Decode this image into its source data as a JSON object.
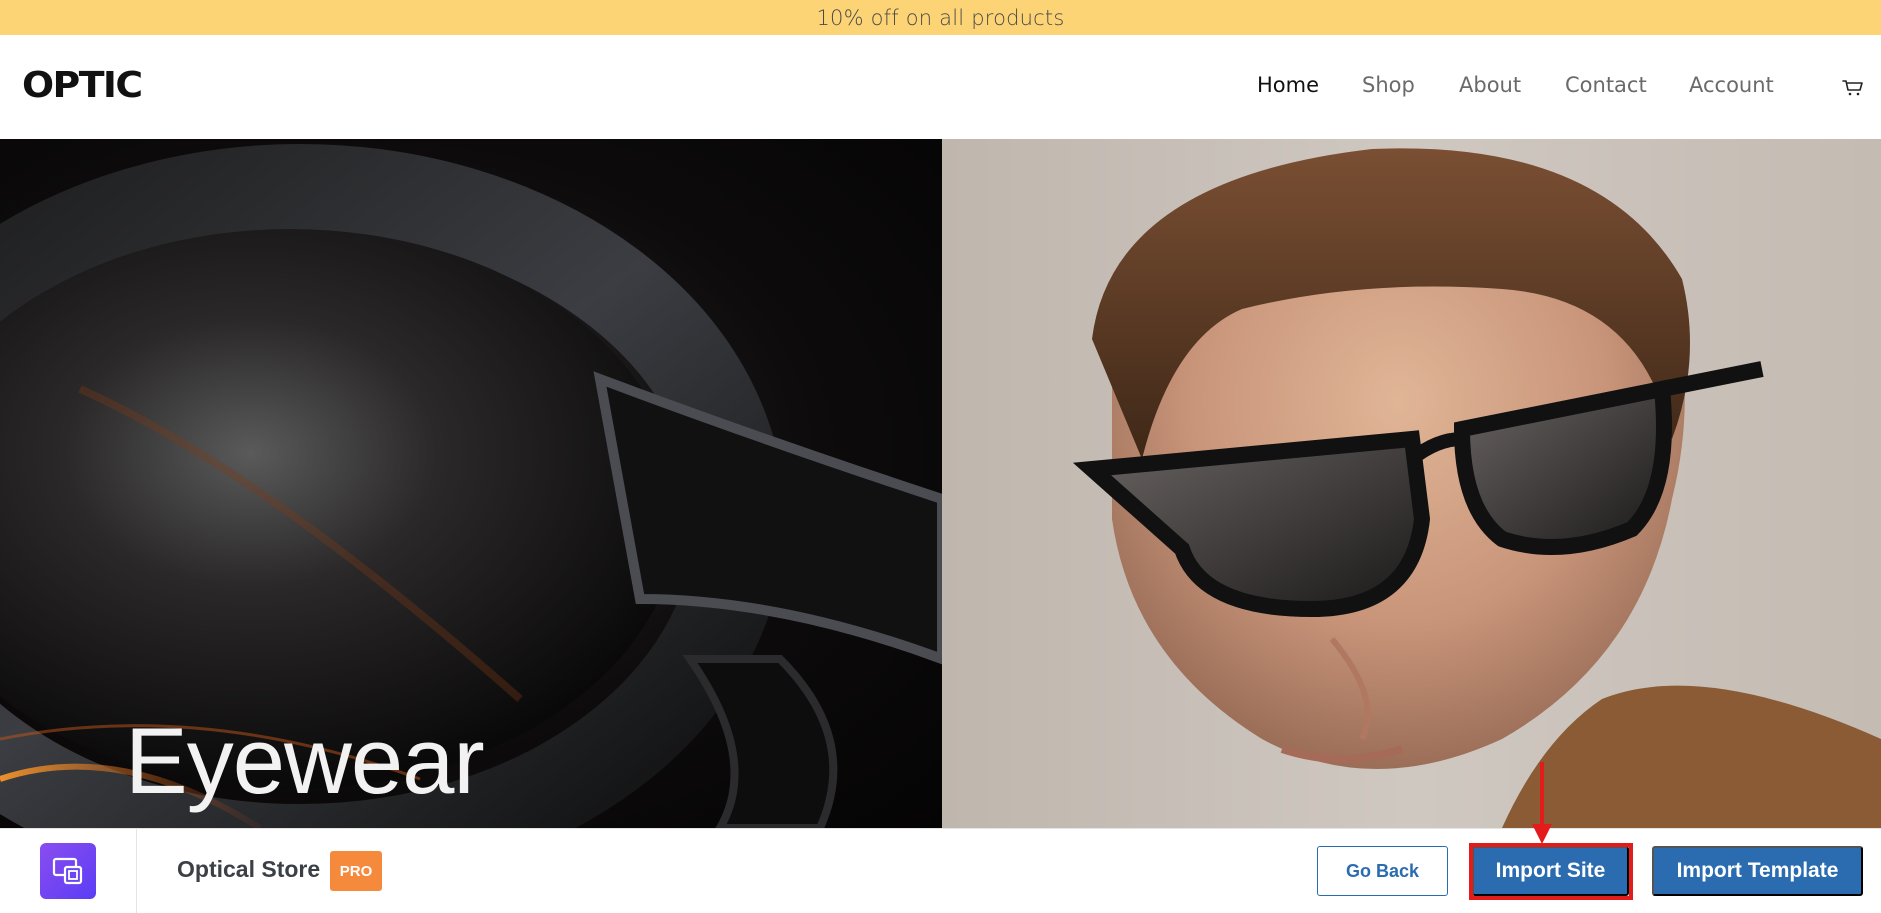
{
  "promo": {
    "text": "10% off on all products"
  },
  "header": {
    "logo": "OPTIC",
    "nav": [
      {
        "label": "Home",
        "active": true
      },
      {
        "label": "Shop",
        "active": false
      },
      {
        "label": "About",
        "active": false
      },
      {
        "label": "Contact",
        "active": false
      },
      {
        "label": "Account",
        "active": false
      }
    ],
    "cart_icon": "cart-icon"
  },
  "hero": {
    "title": "Eyewear",
    "left_image": "sunglasses-closeup",
    "right_image": "man-wearing-sunglasses"
  },
  "import_bar": {
    "site_name": "Optical Store",
    "badge": "PRO",
    "buttons": {
      "go_back": "Go Back",
      "import_site": "Import Site",
      "import_template": "Import Template"
    }
  },
  "colors": {
    "promo_bg": "#fdd475",
    "button_blue": "#2b6cb0",
    "badge_orange": "#f58a3c",
    "highlight_red": "#e41b1b"
  }
}
